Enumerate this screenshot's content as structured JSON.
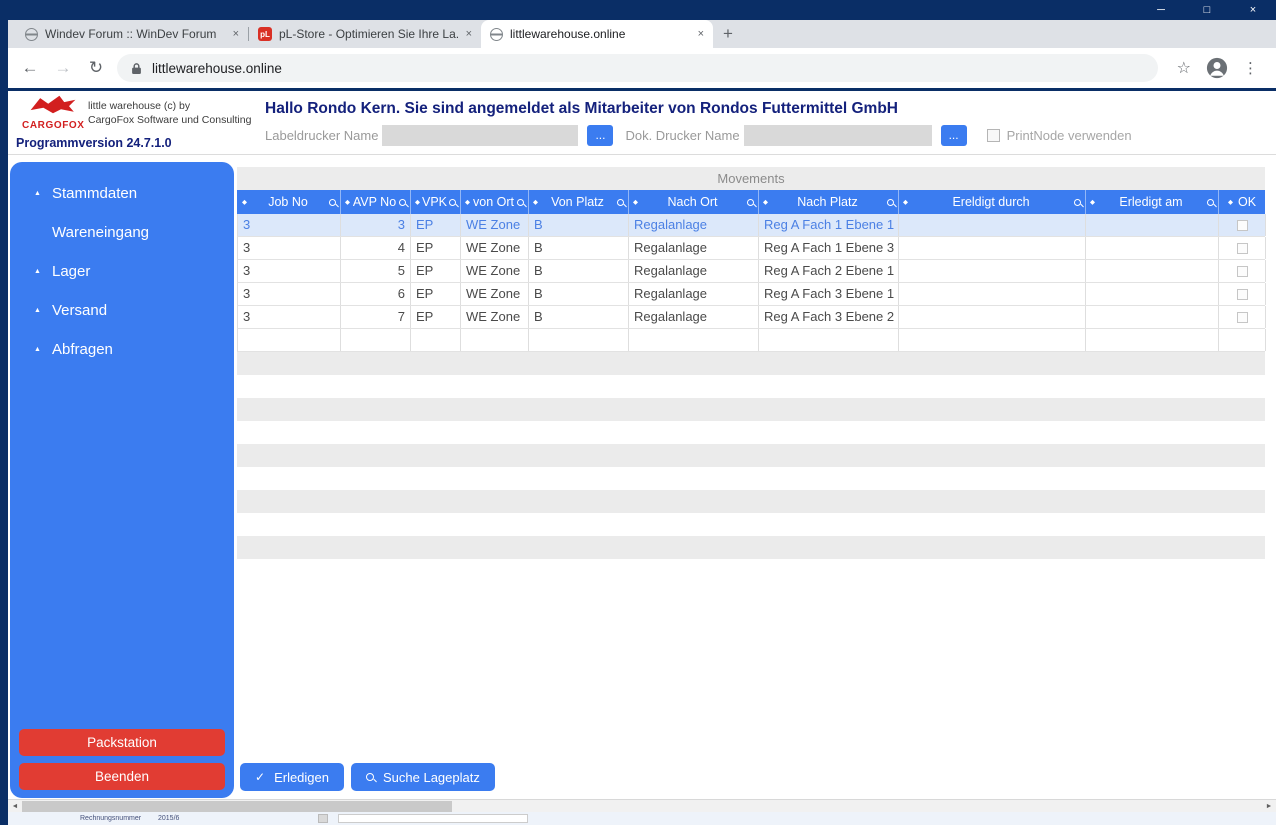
{
  "icons": {
    "minimize": "─",
    "maximize": "□",
    "close": "×",
    "new_tab": "+",
    "back": "←",
    "forward": "→",
    "reload": "↻",
    "star": "☆",
    "menu": "⋮",
    "sort": "◆",
    "menu_arrow": "▲",
    "check": "✓",
    "scroll_left": "◄",
    "scroll_right": "►",
    "pl_favicon": "pL",
    "dots": "..."
  },
  "browser": {
    "tabs": [
      {
        "title": "Windev Forum :: WinDev Forum"
      },
      {
        "title": "pL-Store - Optimieren Sie Ihre La..."
      },
      {
        "title": "littlewarehouse.online"
      }
    ],
    "address": "littlewarehouse.online"
  },
  "app": {
    "brand": "CARGOFOX",
    "credit_line1": "little warehouse (c) by",
    "credit_line2": "CargoFox Software und Consulting",
    "version": "Programmversion 24.7.1.0",
    "greeting": "Hallo Rondo Kern. Sie sind angemeldet als Mitarbeiter von Rondos Futtermittel GmbH",
    "label_printer_label": "Labeldrucker Name",
    "label_printer_value": "",
    "doc_printer_label": "Dok. Drucker Name",
    "doc_printer_value": "",
    "printnode_label": "PrintNode verwenden"
  },
  "sidebar": {
    "items": [
      {
        "label": "Stammdaten",
        "expandable": true
      },
      {
        "label": "Wareneingang",
        "expandable": false
      },
      {
        "label": "Lager",
        "expandable": true
      },
      {
        "label": "Versand",
        "expandable": true
      },
      {
        "label": "Abfragen",
        "expandable": true
      }
    ],
    "packstation": "Packstation",
    "beenden": "Beenden"
  },
  "movements": {
    "title": "Movements",
    "columns": [
      "Job No",
      "AVP No",
      "VPK",
      "von Ort",
      "Von Platz",
      "Nach Ort",
      "Nach Platz",
      "Ereldigt durch",
      "Erledigt am",
      "OK"
    ],
    "rows": [
      [
        "3",
        "3",
        "EP",
        "WE Zone",
        "B",
        "Regalanlage",
        "Reg A Fach 1 Ebene 1",
        "",
        ""
      ],
      [
        "3",
        "4",
        "EP",
        "WE Zone",
        "B",
        "Regalanlage",
        "Reg A Fach 1 Ebene 3",
        "",
        ""
      ],
      [
        "3",
        "5",
        "EP",
        "WE Zone",
        "B",
        "Regalanlage",
        "Reg A Fach 2 Ebene 1",
        "",
        ""
      ],
      [
        "3",
        "6",
        "EP",
        "WE Zone",
        "B",
        "Regalanlage",
        "Reg A Fach 3 Ebene 1",
        "",
        ""
      ],
      [
        "3",
        "7",
        "EP",
        "WE Zone",
        "B",
        "Regalanlage",
        "Reg A Fach 3 Ebene 2",
        "",
        ""
      ]
    ]
  },
  "actions": {
    "erledigen": "Erledigen",
    "suche_lageplatz": "Suche Lageplatz"
  },
  "page_bottom": {
    "label": "Rechnungsnummer",
    "value": "2015/6"
  },
  "colors": {
    "accent_blue": "#3b7cf0",
    "titlebar_navy": "#0a2e66",
    "button_red": "#e13c33",
    "header_text_navy": "#14217c"
  }
}
